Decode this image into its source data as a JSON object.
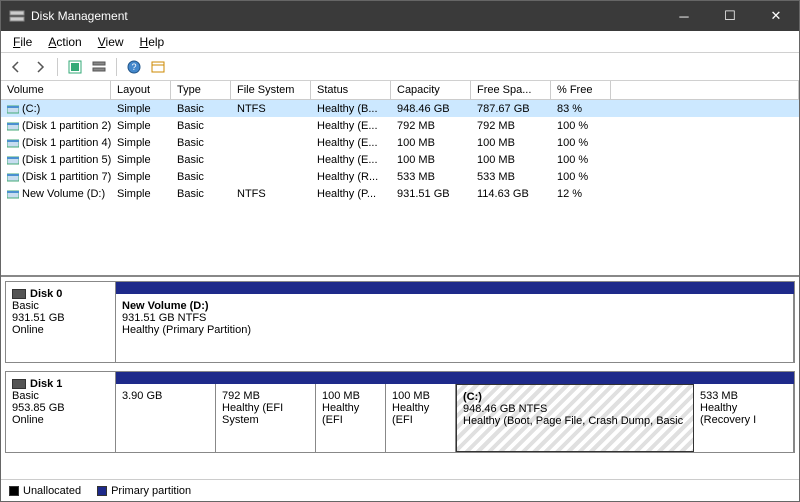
{
  "window": {
    "title": "Disk Management"
  },
  "menu": {
    "file": "File",
    "action": "Action",
    "view": "View",
    "help": "Help"
  },
  "columns": {
    "volume": "Volume",
    "layout": "Layout",
    "type": "Type",
    "fs": "File System",
    "status": "Status",
    "capacity": "Capacity",
    "free": "Free Spa...",
    "pfree": "% Free"
  },
  "rows": [
    {
      "name": "(C:)",
      "layout": "Simple",
      "type": "Basic",
      "fs": "NTFS",
      "status": "Healthy (B...",
      "capacity": "948.46 GB",
      "free": "787.67 GB",
      "pfree": "83 %",
      "selected": true
    },
    {
      "name": "(Disk 1 partition 2)",
      "layout": "Simple",
      "type": "Basic",
      "fs": "",
      "status": "Healthy (E...",
      "capacity": "792 MB",
      "free": "792 MB",
      "pfree": "100 %"
    },
    {
      "name": "(Disk 1 partition 4)",
      "layout": "Simple",
      "type": "Basic",
      "fs": "",
      "status": "Healthy (E...",
      "capacity": "100 MB",
      "free": "100 MB",
      "pfree": "100 %"
    },
    {
      "name": "(Disk 1 partition 5)",
      "layout": "Simple",
      "type": "Basic",
      "fs": "",
      "status": "Healthy (E...",
      "capacity": "100 MB",
      "free": "100 MB",
      "pfree": "100 %"
    },
    {
      "name": "(Disk 1 partition 7)",
      "layout": "Simple",
      "type": "Basic",
      "fs": "",
      "status": "Healthy (R...",
      "capacity": "533 MB",
      "free": "533 MB",
      "pfree": "100 %"
    },
    {
      "name": "New Volume (D:)",
      "layout": "Simple",
      "type": "Basic",
      "fs": "NTFS",
      "status": "Healthy (P...",
      "capacity": "931.51 GB",
      "free": "114.63 GB",
      "pfree": "12 %"
    }
  ],
  "disks": [
    {
      "label": "Disk 0",
      "btype": "Basic",
      "size": "931.51 GB",
      "state": "Online",
      "parts": [
        {
          "name": "New Volume  (D:)",
          "sub": "931.51 GB NTFS",
          "status": "Healthy (Primary Partition)",
          "flex": "1"
        }
      ]
    },
    {
      "label": "Disk 1",
      "btype": "Basic",
      "size": "953.85 GB",
      "state": "Online",
      "parts": [
        {
          "name": "",
          "sub": "3.90 GB",
          "status": "",
          "flex": "0 0 100px"
        },
        {
          "name": "",
          "sub": "792 MB",
          "status": "Healthy (EFI System",
          "flex": "0 0 100px"
        },
        {
          "name": "",
          "sub": "100 MB",
          "status": "Healthy (EFI",
          "flex": "0 0 70px"
        },
        {
          "name": "",
          "sub": "100 MB",
          "status": "Healthy (EFI",
          "flex": "0 0 70px"
        },
        {
          "name": "(C:)",
          "sub": "948.46 GB NTFS",
          "status": "Healthy (Boot, Page File, Crash Dump, Basic",
          "flex": "1",
          "active": true
        },
        {
          "name": "",
          "sub": "533 MB",
          "status": "Healthy (Recovery I",
          "flex": "0 0 100px"
        }
      ]
    }
  ],
  "legend": {
    "unalloc": "Unallocated",
    "primary": "Primary partition"
  }
}
